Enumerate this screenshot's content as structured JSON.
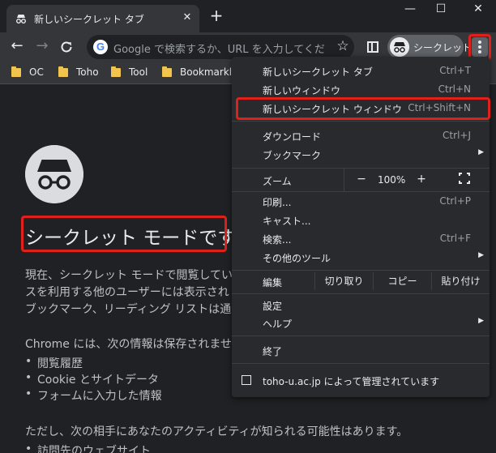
{
  "tab": {
    "title": "新しいシークレット タブ",
    "icon": "incognito-icon",
    "close_glyph": "✕"
  },
  "window_controls": {
    "minimize": "—",
    "maximize": "☐",
    "close": "✕"
  },
  "new_tab_glyph": "+",
  "toolbar": {
    "back_glyph": "←",
    "forward_glyph": "→",
    "reload_glyph": "C",
    "omnibox_placeholder": "Google で検索するか、URL を入力してください",
    "google_letter": "G",
    "star_glyph": "☆",
    "profile_label": "シークレット"
  },
  "bookmarks": [
    {
      "label": "OC"
    },
    {
      "label": "Toho"
    },
    {
      "label": "Tool"
    },
    {
      "label": "Bookmarklet"
    }
  ],
  "page": {
    "title": "シークレット モードです",
    "para1": [
      "現在、シークレット モードで閲覧してい",
      "スを利用する他のユーザーには表示され",
      "ブックマーク、リーディング リストは通"
    ],
    "saved_heading": "Chrome には、次の情報は保存されません",
    "saved_items": [
      "閲覧履歴",
      "Cookie とサイトデータ",
      "フォームに入力した情報"
    ],
    "visible_heading": "ただし、次の相手にあなたのアクティビティが知られる可能性はあります。",
    "visible_items": [
      "訪問先のウェブサイト"
    ]
  },
  "menu": {
    "items_top": [
      {
        "label": "新しいシークレット タブ",
        "shortcut": "Ctrl+T"
      },
      {
        "label": "新しいウィンドウ",
        "shortcut": "Ctrl+N"
      },
      {
        "label": "新しいシークレット ウィンドウ",
        "shortcut": "Ctrl+Shift+N"
      }
    ],
    "items_mid": [
      {
        "label": "ダウンロード",
        "shortcut": "Ctrl+J"
      },
      {
        "label": "ブックマーク",
        "shortcut": ""
      }
    ],
    "zoom": {
      "label": "ズーム",
      "minus": "−",
      "value": "100%",
      "plus": "+"
    },
    "items_tools": [
      {
        "label": "印刷...",
        "shortcut": "Ctrl+P"
      },
      {
        "label": "キャスト...",
        "shortcut": ""
      },
      {
        "label": "検索...",
        "shortcut": "Ctrl+F"
      },
      {
        "label": "その他のツール",
        "shortcut": ""
      }
    ],
    "edit": {
      "label": "編集",
      "cut": "切り取り",
      "copy": "コピー",
      "paste": "貼り付け"
    },
    "items_settings": [
      {
        "label": "設定"
      },
      {
        "label": "ヘルプ"
      }
    ],
    "exit_label": "終了",
    "managed_label": "toho-u.ac.jp によって管理されています"
  },
  "colors": {
    "highlight": "#e0201a",
    "background": "#202124",
    "menu_bg": "#292a2d"
  }
}
